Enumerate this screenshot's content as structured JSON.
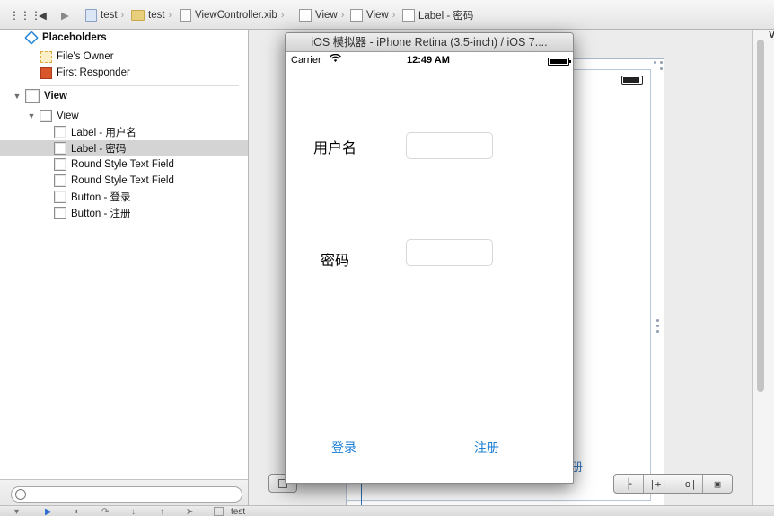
{
  "jumpbar": {
    "items": [
      "test",
      "test",
      "ViewController.xib",
      "View",
      "View",
      "Label - 密码"
    ],
    "nav_back": "◀",
    "nav_forward": "▶",
    "grid_icon": "grid-icon"
  },
  "outline": {
    "placeholders": "Placeholders",
    "files_owner": "File's Owner",
    "first_responder": "First Responder",
    "view_root": "View",
    "view_child": "View",
    "items": [
      "Label - 用户名",
      "Label - 密码",
      "Round Style Text Field",
      "Round Style Text Field",
      "Button - 登录",
      "Button - 注册"
    ],
    "selected_index": 1
  },
  "simulator": {
    "title": "iOS 模拟器 - iPhone Retina (3.5-inch) / iOS 7....",
    "carrier": "Carrier",
    "time": "12:49 AM",
    "username_label": "用户名",
    "password_label": "密码",
    "login_button": "登录",
    "register_button": "注册"
  },
  "canvas": {
    "fragment": "册"
  },
  "bottombar": {
    "scheme": "test"
  },
  "right_panel": {
    "letter": "V"
  },
  "colors": {
    "accent": "#1a7fd4",
    "selection": "#d4d4d4"
  }
}
